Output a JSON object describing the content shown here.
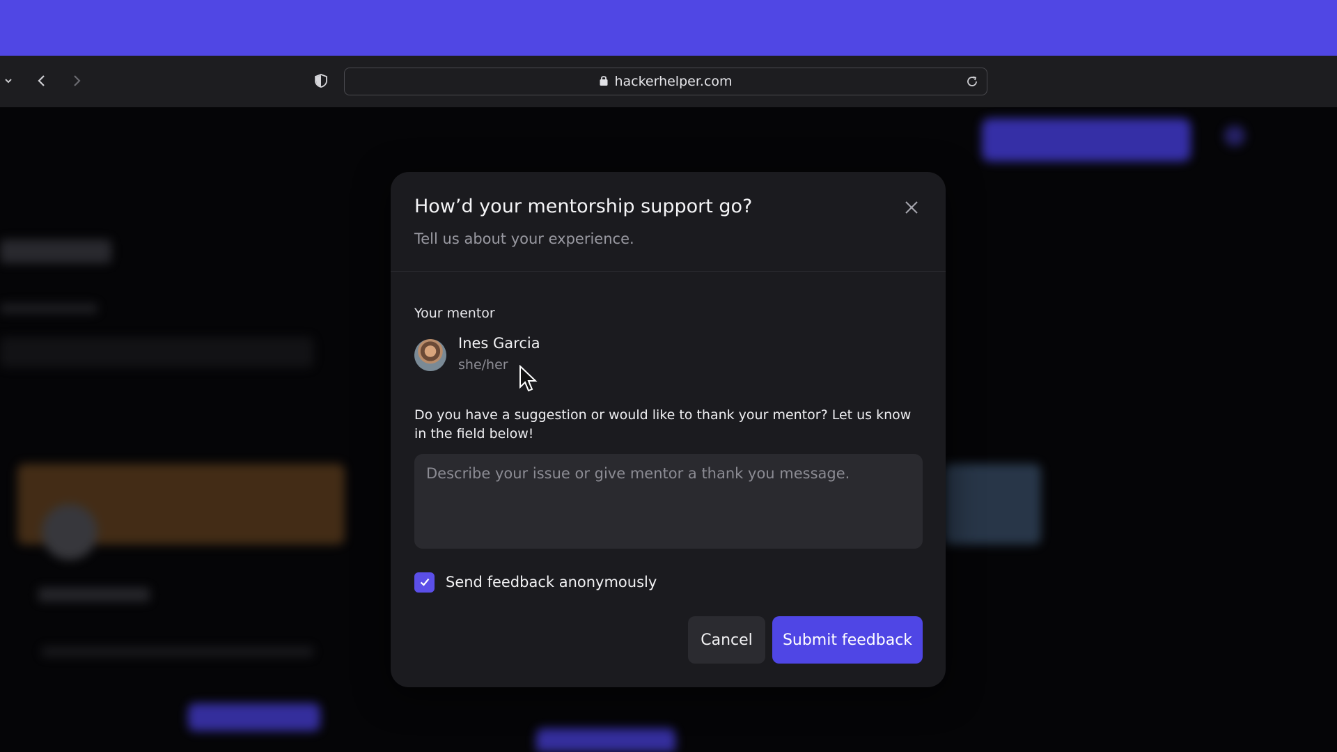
{
  "browser": {
    "url": "hackerhelper.com",
    "icons": [
      "chevron-down-icon",
      "back-icon",
      "forward-icon",
      "shield-icon",
      "lock-icon",
      "reload-icon"
    ]
  },
  "modal": {
    "title": "How’d your mentorship support go?",
    "subtitle": "Tell us about your experience.",
    "mentor_label": "Your mentor",
    "mentor": {
      "name": "Ines Garcia",
      "pronouns": "she/her"
    },
    "prompt": "Do you have a suggestion or would like to thank your mentor? Let us know in the field below!",
    "textarea": {
      "value": "",
      "placeholder": "Describe your issue or give mentor a thank you message."
    },
    "anonymous": {
      "label": "Send feedback anonymously",
      "checked": true
    },
    "buttons": {
      "cancel": "Cancel",
      "submit": "Submit feedback"
    }
  },
  "colors": {
    "accent": "#4f46e5",
    "top_band": "#5047e4",
    "modal_bg": "#1b1b1f",
    "page_bg": "#050507"
  }
}
